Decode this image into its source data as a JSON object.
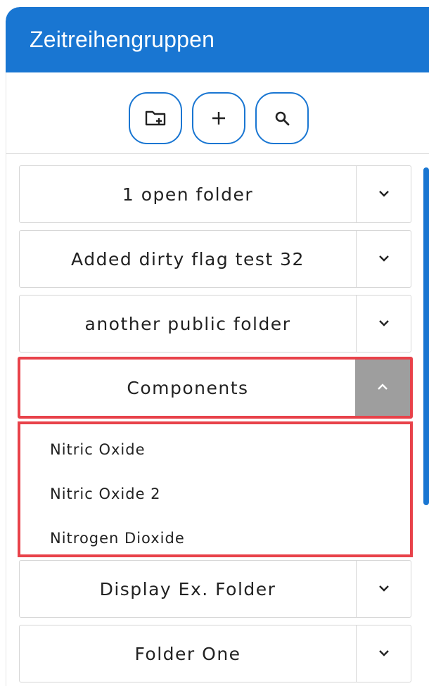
{
  "header": {
    "title": "Zeitreihengruppen"
  },
  "toolbar": {
    "buttons": [
      {
        "name": "new-folder-button",
        "icon": "new-folder-icon"
      },
      {
        "name": "add-button",
        "icon": "plus-icon"
      },
      {
        "name": "search-button",
        "icon": "search-icon"
      }
    ]
  },
  "folders": [
    {
      "label": "1 open folder",
      "expanded": false
    },
    {
      "label": "Added dirty flag test 32",
      "expanded": false
    },
    {
      "label": "another public folder",
      "expanded": false
    },
    {
      "label": "Components",
      "expanded": true,
      "children": [
        "Nitric Oxide",
        "Nitric Oxide 2",
        "Nitrogen Dioxide"
      ]
    },
    {
      "label": "Display Ex. Folder",
      "expanded": false
    },
    {
      "label": "Folder One",
      "expanded": false
    }
  ],
  "colors": {
    "accent": "#1976d2",
    "highlight": "#e8424a",
    "active_chevron_bg": "#9e9e9e"
  }
}
